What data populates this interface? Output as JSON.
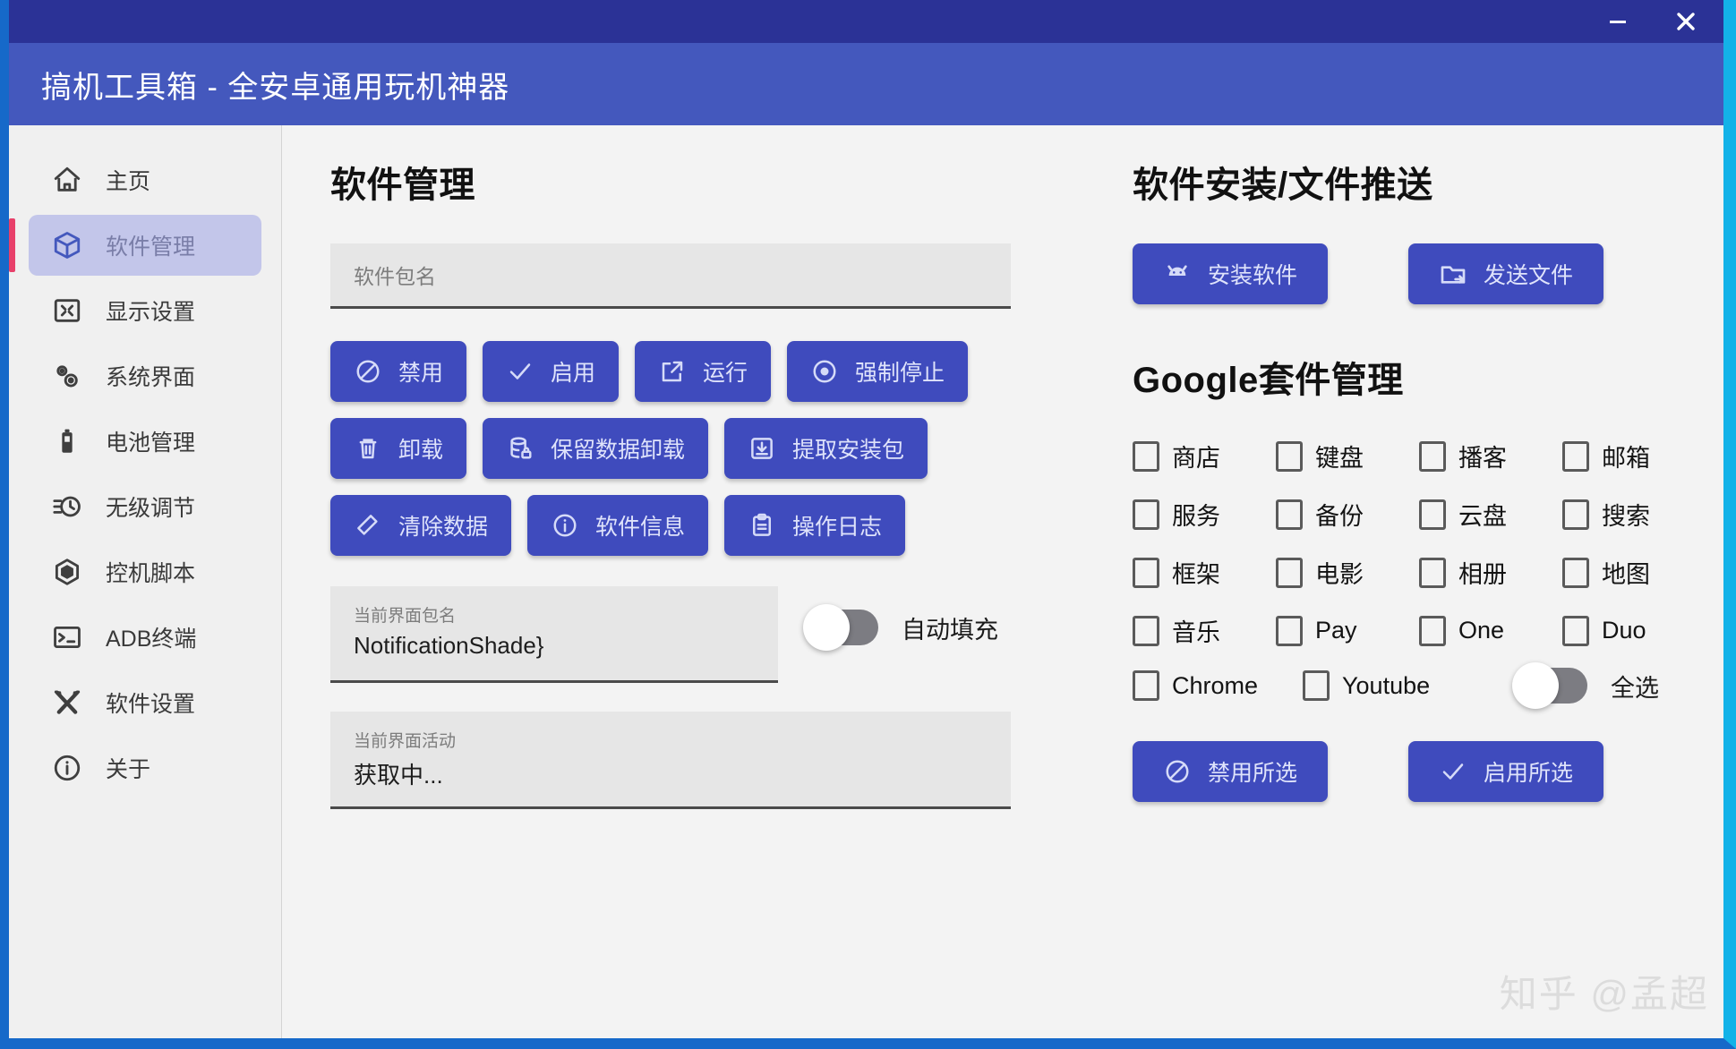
{
  "window": {
    "title": "搞机工具箱 - 全安卓通用玩机神器",
    "controls": [
      {
        "name": "minimize-button",
        "glyph": "minimize-icon"
      },
      {
        "name": "close-button",
        "glyph": "close-icon"
      }
    ],
    "colors": {
      "titlebar_top": "#2b3296",
      "titlebar_main": "#4458bd",
      "accent_button": "#3f4bbd",
      "active_nav_bg": "#c3c6ea",
      "active_nav_marker": "#e8406a",
      "border_left": "#1669c9",
      "border_right": "#13b2e8"
    },
    "watermark": "知乎 @孟超"
  },
  "sidebar": {
    "items": [
      {
        "label": "主页",
        "icon": "home-icon",
        "active": false
      },
      {
        "label": "软件管理",
        "icon": "package-icon",
        "active": true
      },
      {
        "label": "显示设置",
        "icon": "display-icon",
        "active": false
      },
      {
        "label": "系统界面",
        "icon": "gears-icon",
        "active": false
      },
      {
        "label": "电池管理",
        "icon": "battery-icon",
        "active": false
      },
      {
        "label": "无级调节",
        "icon": "clock-slider-icon",
        "active": false
      },
      {
        "label": "控机脚本",
        "icon": "hexagon-icon",
        "active": false
      },
      {
        "label": "ADB终端",
        "icon": "terminal-icon",
        "active": false
      },
      {
        "label": "软件设置",
        "icon": "tools-icon",
        "active": false
      },
      {
        "label": "关于",
        "icon": "info-icon",
        "active": false
      }
    ]
  },
  "app_management": {
    "title": "软件管理",
    "package_input": {
      "placeholder": "软件包名",
      "value": ""
    },
    "buttons": [
      [
        {
          "label": "禁用",
          "icon": "ban-icon"
        },
        {
          "label": "启用",
          "icon": "check-icon"
        },
        {
          "label": "运行",
          "icon": "external-link-icon"
        },
        {
          "label": "强制停止",
          "icon": "stop-circle-icon"
        }
      ],
      [
        {
          "label": "卸载",
          "icon": "trash-icon"
        },
        {
          "label": "保留数据卸载",
          "icon": "database-lock-icon"
        },
        {
          "label": "提取安装包",
          "icon": "download-box-icon"
        }
      ],
      [
        {
          "label": "清除数据",
          "icon": "eraser-icon"
        },
        {
          "label": "软件信息",
          "icon": "info-circle-icon"
        },
        {
          "label": "操作日志",
          "icon": "clipboard-icon"
        }
      ]
    ],
    "current_package": {
      "label": "当前界面包名",
      "value": "NotificationShade}"
    },
    "current_activity": {
      "label": "当前界面活动",
      "value": "获取中..."
    },
    "autofill_toggle": {
      "label": "自动填充",
      "on": false
    }
  },
  "install_push": {
    "title": "软件安装/文件推送",
    "buttons": [
      {
        "label": "安装软件",
        "icon": "android-icon"
      },
      {
        "label": "发送文件",
        "icon": "folder-send-icon"
      }
    ]
  },
  "google_suite": {
    "title": "Google套件管理",
    "checkboxes": [
      {
        "label": "商店",
        "checked": false
      },
      {
        "label": "键盘",
        "checked": false
      },
      {
        "label": "播客",
        "checked": false
      },
      {
        "label": "邮箱",
        "checked": false
      },
      {
        "label": "服务",
        "checked": false
      },
      {
        "label": "备份",
        "checked": false
      },
      {
        "label": "云盘",
        "checked": false
      },
      {
        "label": "搜索",
        "checked": false
      },
      {
        "label": "框架",
        "checked": false
      },
      {
        "label": "电影",
        "checked": false
      },
      {
        "label": "相册",
        "checked": false
      },
      {
        "label": "地图",
        "checked": false
      },
      {
        "label": "音乐",
        "checked": false
      },
      {
        "label": "Pay",
        "checked": false
      },
      {
        "label": "One",
        "checked": false
      },
      {
        "label": "Duo",
        "checked": false
      }
    ],
    "last_row": [
      {
        "label": "Chrome",
        "checked": false
      },
      {
        "label": "Youtube",
        "checked": false
      }
    ],
    "select_all_toggle": {
      "label": "全选",
      "on": false
    },
    "buttons": [
      {
        "label": "禁用所选",
        "icon": "ban-icon"
      },
      {
        "label": "启用所选",
        "icon": "check-icon"
      }
    ]
  }
}
